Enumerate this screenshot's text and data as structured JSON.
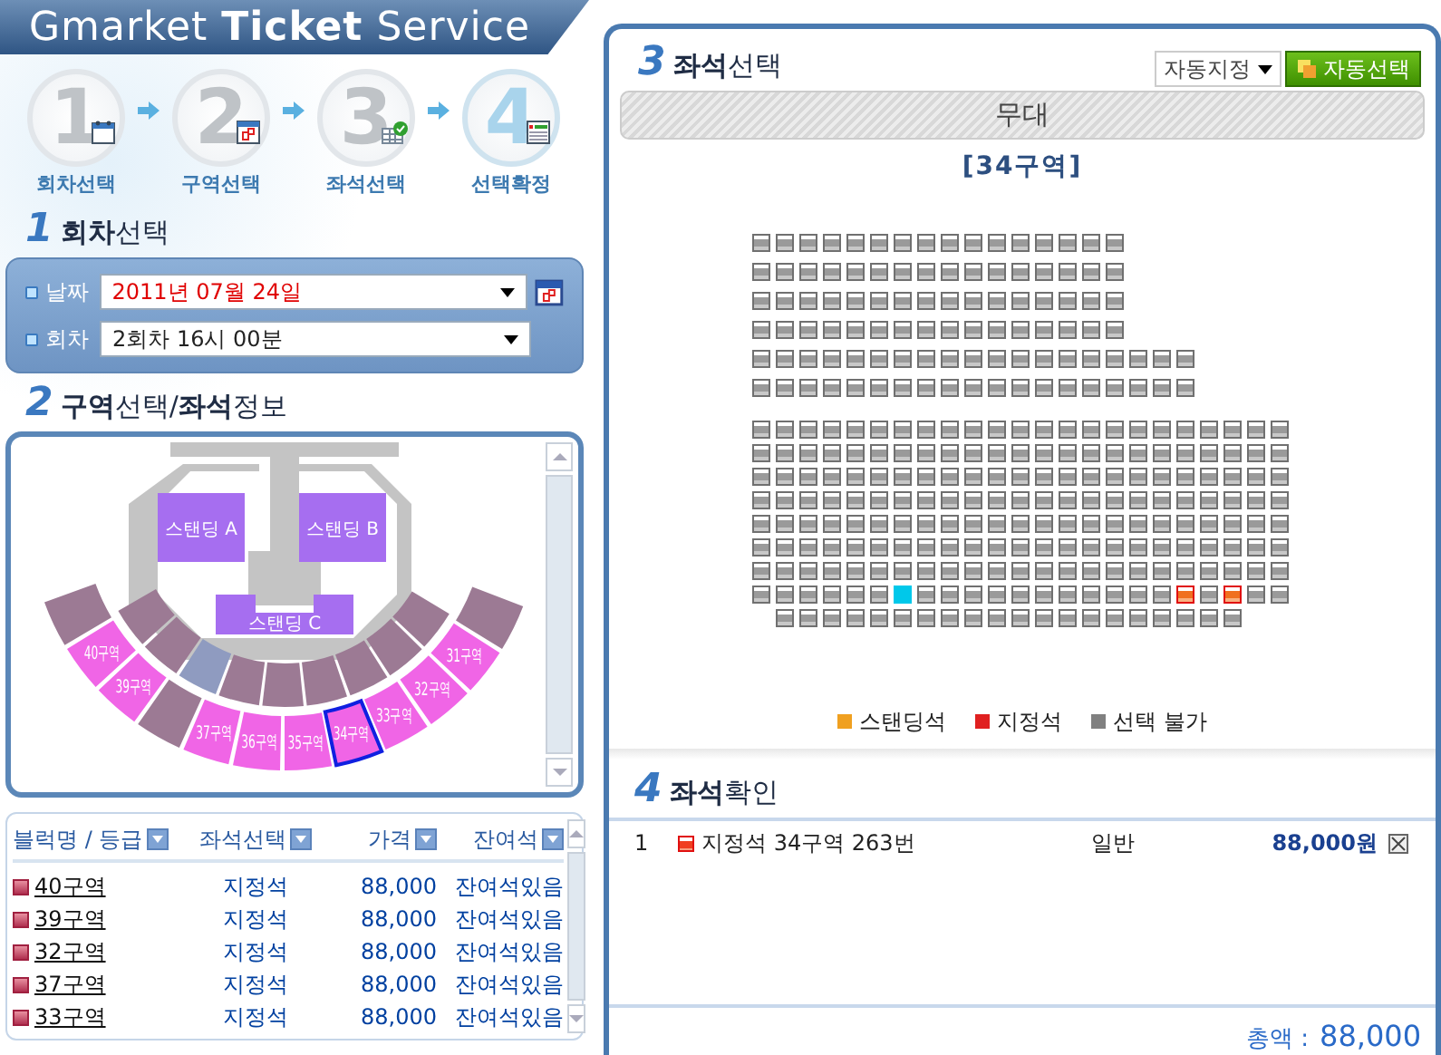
{
  "header": {
    "title": "Gmarket **Ticket** Service"
  },
  "steps": [
    {
      "number": "1",
      "label": "회차선택",
      "selected": false
    },
    {
      "number": "2",
      "label": "구역선택",
      "selected": false
    },
    {
      "number": "3",
      "label": "좌석선택",
      "selected": false
    },
    {
      "number": "4",
      "label": "선택확정",
      "selected": true
    }
  ],
  "session": {
    "number": "1",
    "title": "**회차**선택",
    "fields": [
      {
        "label": "날짜",
        "value": "2011년 07월 24일",
        "highlight": true
      },
      {
        "label": "회차",
        "value": "2회차 16시 00분",
        "highlight": false
      }
    ]
  },
  "area": {
    "number": "2",
    "title": "**구역**선택/**좌석**정보",
    "standing": [
      "스탠딩 A",
      "스탠딩 B",
      "스탠딩 C"
    ],
    "outer_sections": [
      {
        "kind": "closed",
        "selected": false
      },
      {
        "label": "40구역",
        "kind": "open",
        "selected": false
      },
      {
        "label": "39구역",
        "kind": "open",
        "selected": false
      },
      {
        "kind": "closed",
        "selected": false
      },
      {
        "label": "37구역",
        "kind": "open",
        "selected": false
      },
      {
        "label": "36구역",
        "kind": "open",
        "selected": false
      },
      {
        "label": "35구역",
        "kind": "open",
        "selected": false
      },
      {
        "label": "34구역",
        "kind": "open",
        "selected": true
      },
      {
        "label": "33구역",
        "kind": "open",
        "selected": false
      },
      {
        "label": "32구역",
        "kind": "open",
        "selected": false
      },
      {
        "label": "31구역",
        "kind": "open",
        "selected": false
      },
      {
        "kind": "closed",
        "selected": false
      }
    ],
    "inner_sections": [
      {
        "kind": "closed"
      },
      {
        "kind": "closed"
      },
      {
        "kind": "family"
      },
      {
        "kind": "closed"
      },
      {
        "kind": "closed"
      },
      {
        "kind": "closed"
      },
      {
        "kind": "closed"
      },
      {
        "kind": "closed"
      },
      {
        "kind": "closed"
      }
    ],
    "table": {
      "columns": [
        "블럭명 / 등급",
        "좌석선택",
        "가격",
        "잔여석"
      ],
      "rows": [
        {
          "block": "40구역",
          "type": "지정석",
          "price": "88,000",
          "remaining": "잔여석있음"
        },
        {
          "block": "39구역",
          "type": "지정석",
          "price": "88,000",
          "remaining": "잔여석있음"
        },
        {
          "block": "32구역",
          "type": "지정석",
          "price": "88,000",
          "remaining": "잔여석있음"
        },
        {
          "block": "37구역",
          "type": "지정석",
          "price": "88,000",
          "remaining": "잔여석있음"
        },
        {
          "block": "33구역",
          "type": "지정석",
          "price": "88,000",
          "remaining": "잔여석있음"
        }
      ]
    }
  },
  "seating": {
    "number": "3",
    "title": "**좌석**선택",
    "mode": "자동지정",
    "auto_button": "자동선택",
    "stage": "무대",
    "section": "[34구역]",
    "blocks": [
      {
        "rows": [
          {
            "seats": [
              {
                "kind": "off"
              },
              {
                "kind": "off"
              },
              {
                "kind": "off"
              },
              {
                "kind": "off"
              },
              {
                "kind": "off"
              },
              {
                "kind": "off"
              },
              {
                "kind": "off"
              },
              {
                "kind": "off"
              },
              {
                "kind": "off"
              },
              {
                "kind": "off"
              },
              {
                "kind": "off"
              },
              {
                "kind": "off"
              },
              {
                "kind": "off"
              },
              {
                "kind": "off"
              },
              {
                "kind": "off"
              },
              {
                "kind": "off"
              }
            ]
          },
          {
            "seats": [
              {
                "kind": "off"
              },
              {
                "kind": "off"
              },
              {
                "kind": "off"
              },
              {
                "kind": "off"
              },
              {
                "kind": "off"
              },
              {
                "kind": "off"
              },
              {
                "kind": "off"
              },
              {
                "kind": "off"
              },
              {
                "kind": "off"
              },
              {
                "kind": "off"
              },
              {
                "kind": "off"
              },
              {
                "kind": "off"
              },
              {
                "kind": "off"
              },
              {
                "kind": "off"
              },
              {
                "kind": "off"
              },
              {
                "kind": "off"
              }
            ]
          },
          {
            "seats": [
              {
                "kind": "off"
              },
              {
                "kind": "off"
              },
              {
                "kind": "off"
              },
              {
                "kind": "off"
              },
              {
                "kind": "off"
              },
              {
                "kind": "off"
              },
              {
                "kind": "off"
              },
              {
                "kind": "off"
              },
              {
                "kind": "off"
              },
              {
                "kind": "off"
              },
              {
                "kind": "off"
              },
              {
                "kind": "off"
              },
              {
                "kind": "off"
              },
              {
                "kind": "off"
              },
              {
                "kind": "off"
              },
              {
                "kind": "off"
              }
            ]
          },
          {
            "seats": [
              {
                "kind": "off"
              },
              {
                "kind": "off"
              },
              {
                "kind": "off"
              },
              {
                "kind": "off"
              },
              {
                "kind": "off"
              },
              {
                "kind": "off"
              },
              {
                "kind": "off"
              },
              {
                "kind": "off"
              },
              {
                "kind": "off"
              },
              {
                "kind": "off"
              },
              {
                "kind": "off"
              },
              {
                "kind": "off"
              },
              {
                "kind": "off"
              },
              {
                "kind": "off"
              },
              {
                "kind": "off"
              },
              {
                "kind": "off"
              }
            ]
          },
          {
            "seats": [
              {
                "kind": "off"
              },
              {
                "kind": "off"
              },
              {
                "kind": "off"
              },
              {
                "kind": "off"
              },
              {
                "kind": "off"
              },
              {
                "kind": "off"
              },
              {
                "kind": "off"
              },
              {
                "kind": "off"
              },
              {
                "kind": "off"
              },
              {
                "kind": "off"
              },
              {
                "kind": "off"
              },
              {
                "kind": "off"
              },
              {
                "kind": "off"
              },
              {
                "kind": "off"
              },
              {
                "kind": "off"
              },
              {
                "kind": "off"
              },
              {
                "kind": "off"
              },
              {
                "kind": "off"
              },
              {
                "kind": "off"
              }
            ]
          },
          {
            "seats": [
              {
                "kind": "off"
              },
              {
                "kind": "off"
              },
              {
                "kind": "off"
              },
              {
                "kind": "off"
              },
              {
                "kind": "off"
              },
              {
                "kind": "off"
              },
              {
                "kind": "off"
              },
              {
                "kind": "off"
              },
              {
                "kind": "off"
              },
              {
                "kind": "off"
              },
              {
                "kind": "off"
              },
              {
                "kind": "off"
              },
              {
                "kind": "off"
              },
              {
                "kind": "off"
              },
              {
                "kind": "off"
              },
              {
                "kind": "off"
              },
              {
                "kind": "off"
              },
              {
                "kind": "off"
              },
              {
                "kind": "off"
              }
            ]
          }
        ]
      },
      {
        "rows": [
          {
            "seats": [
              {
                "kind": "off"
              },
              {
                "kind": "off"
              },
              {
                "kind": "off"
              },
              {
                "kind": "off"
              },
              {
                "kind": "off"
              },
              {
                "kind": "off"
              },
              {
                "kind": "off"
              },
              {
                "kind": "off"
              },
              {
                "kind": "off"
              },
              {
                "kind": "off"
              },
              {
                "kind": "off"
              },
              {
                "kind": "off"
              },
              {
                "kind": "off"
              },
              {
                "kind": "off"
              },
              {
                "kind": "off"
              },
              {
                "kind": "off"
              },
              {
                "kind": "off"
              },
              {
                "kind": "off"
              },
              {
                "kind": "off"
              },
              {
                "kind": "off"
              },
              {
                "kind": "off"
              },
              {
                "kind": "off"
              },
              {
                "kind": "off"
              }
            ]
          },
          {
            "seats": [
              {
                "kind": "off"
              },
              {
                "kind": "off"
              },
              {
                "kind": "off"
              },
              {
                "kind": "off"
              },
              {
                "kind": "off"
              },
              {
                "kind": "off"
              },
              {
                "kind": "off"
              },
              {
                "kind": "off"
              },
              {
                "kind": "off"
              },
              {
                "kind": "off"
              },
              {
                "kind": "off"
              },
              {
                "kind": "off"
              },
              {
                "kind": "off"
              },
              {
                "kind": "off"
              },
              {
                "kind": "off"
              },
              {
                "kind": "off"
              },
              {
                "kind": "off"
              },
              {
                "kind": "off"
              },
              {
                "kind": "off"
              },
              {
                "kind": "off"
              },
              {
                "kind": "off"
              },
              {
                "kind": "off"
              },
              {
                "kind": "off"
              }
            ]
          },
          {
            "seats": [
              {
                "kind": "off"
              },
              {
                "kind": "off"
              },
              {
                "kind": "off"
              },
              {
                "kind": "off"
              },
              {
                "kind": "off"
              },
              {
                "kind": "off"
              },
              {
                "kind": "off"
              },
              {
                "kind": "off"
              },
              {
                "kind": "off"
              },
              {
                "kind": "off"
              },
              {
                "kind": "off"
              },
              {
                "kind": "off"
              },
              {
                "kind": "off"
              },
              {
                "kind": "off"
              },
              {
                "kind": "off"
              },
              {
                "kind": "off"
              },
              {
                "kind": "off"
              },
              {
                "kind": "off"
              },
              {
                "kind": "off"
              },
              {
                "kind": "off"
              },
              {
                "kind": "off"
              },
              {
                "kind": "off"
              },
              {
                "kind": "off"
              }
            ]
          },
          {
            "seats": [
              {
                "kind": "off"
              },
              {
                "kind": "off"
              },
              {
                "kind": "off"
              },
              {
                "kind": "off"
              },
              {
                "kind": "off"
              },
              {
                "kind": "off"
              },
              {
                "kind": "off"
              },
              {
                "kind": "off"
              },
              {
                "kind": "off"
              },
              {
                "kind": "off"
              },
              {
                "kind": "off"
              },
              {
                "kind": "off"
              },
              {
                "kind": "off"
              },
              {
                "kind": "off"
              },
              {
                "kind": "off"
              },
              {
                "kind": "off"
              },
              {
                "kind": "off"
              },
              {
                "kind": "off"
              },
              {
                "kind": "off"
              },
              {
                "kind": "off"
              },
              {
                "kind": "off"
              },
              {
                "kind": "off"
              },
              {
                "kind": "off"
              }
            ]
          },
          {
            "seats": [
              {
                "kind": "off"
              },
              {
                "kind": "off"
              },
              {
                "kind": "off"
              },
              {
                "kind": "off"
              },
              {
                "kind": "off"
              },
              {
                "kind": "off"
              },
              {
                "kind": "off"
              },
              {
                "kind": "off"
              },
              {
                "kind": "off"
              },
              {
                "kind": "off"
              },
              {
                "kind": "off"
              },
              {
                "kind": "off"
              },
              {
                "kind": "off"
              },
              {
                "kind": "off"
              },
              {
                "kind": "off"
              },
              {
                "kind": "off"
              },
              {
                "kind": "off"
              },
              {
                "kind": "off"
              },
              {
                "kind": "off"
              },
              {
                "kind": "off"
              },
              {
                "kind": "off"
              },
              {
                "kind": "off"
              },
              {
                "kind": "off"
              }
            ]
          },
          {
            "seats": [
              {
                "kind": "off"
              },
              {
                "kind": "off"
              },
              {
                "kind": "off"
              },
              {
                "kind": "off"
              },
              {
                "kind": "off"
              },
              {
                "kind": "off"
              },
              {
                "kind": "off"
              },
              {
                "kind": "off"
              },
              {
                "kind": "off"
              },
              {
                "kind": "off"
              },
              {
                "kind": "off"
              },
              {
                "kind": "off"
              },
              {
                "kind": "off"
              },
              {
                "kind": "off"
              },
              {
                "kind": "off"
              },
              {
                "kind": "off"
              },
              {
                "kind": "off"
              },
              {
                "kind": "off"
              },
              {
                "kind": "off"
              },
              {
                "kind": "off"
              },
              {
                "kind": "off"
              },
              {
                "kind": "off"
              },
              {
                "kind": "off"
              }
            ]
          },
          {
            "seats": [
              {
                "kind": "off"
              },
              {
                "kind": "off"
              },
              {
                "kind": "off"
              },
              {
                "kind": "off"
              },
              {
                "kind": "off"
              },
              {
                "kind": "off"
              },
              {
                "kind": "off"
              },
              {
                "kind": "off"
              },
              {
                "kind": "off"
              },
              {
                "kind": "off"
              },
              {
                "kind": "off"
              },
              {
                "kind": "off"
              },
              {
                "kind": "off"
              },
              {
                "kind": "off"
              },
              {
                "kind": "off"
              },
              {
                "kind": "off"
              },
              {
                "kind": "off"
              },
              {
                "kind": "off"
              },
              {
                "kind": "off"
              },
              {
                "kind": "off"
              },
              {
                "kind": "off"
              },
              {
                "kind": "off"
              },
              {
                "kind": "off"
              }
            ]
          },
          {
            "seats": [
              {
                "kind": "off"
              },
              {
                "kind": "off"
              },
              {
                "kind": "off"
              },
              {
                "kind": "off"
              },
              {
                "kind": "off"
              },
              {
                "kind": "off"
              },
              {
                "kind": "sel"
              },
              {
                "kind": "off"
              },
              {
                "kind": "off"
              },
              {
                "kind": "off"
              },
              {
                "kind": "off"
              },
              {
                "kind": "off"
              },
              {
                "kind": "off"
              },
              {
                "kind": "off"
              },
              {
                "kind": "off"
              },
              {
                "kind": "off"
              },
              {
                "kind": "off"
              },
              {
                "kind": "off"
              },
              {
                "kind": "on"
              },
              {
                "kind": "off"
              },
              {
                "kind": "on"
              },
              {
                "kind": "off"
              },
              {
                "kind": "off"
              }
            ]
          },
          {
            "seats": [
              {
                "kind": "gap"
              },
              {
                "kind": "off"
              },
              {
                "kind": "off"
              },
              {
                "kind": "off"
              },
              {
                "kind": "off"
              },
              {
                "kind": "off"
              },
              {
                "kind": "off"
              },
              {
                "kind": "off"
              },
              {
                "kind": "off"
              },
              {
                "kind": "off"
              },
              {
                "kind": "off"
              },
              {
                "kind": "off"
              },
              {
                "kind": "off"
              },
              {
                "kind": "off"
              },
              {
                "kind": "off"
              },
              {
                "kind": "off"
              },
              {
                "kind": "off"
              },
              {
                "kind": "off"
              },
              {
                "kind": "off"
              },
              {
                "kind": "off"
              },
              {
                "kind": "off"
              }
            ]
          }
        ]
      }
    ],
    "legend": [
      {
        "label": "스탠딩석",
        "color": "#f0a020"
      },
      {
        "label": "지정석",
        "color": "#e02020"
      },
      {
        "label": "선택 불가",
        "color": "#808080"
      }
    ]
  },
  "confirm": {
    "number": "4",
    "title": "**좌석**확인",
    "items": [
      {
        "index": "1",
        "seat": "지정석 34구역 263번",
        "grade": "일반",
        "price": "88,000원"
      }
    ],
    "total_label": "총액 :",
    "total": "88,000"
  }
}
